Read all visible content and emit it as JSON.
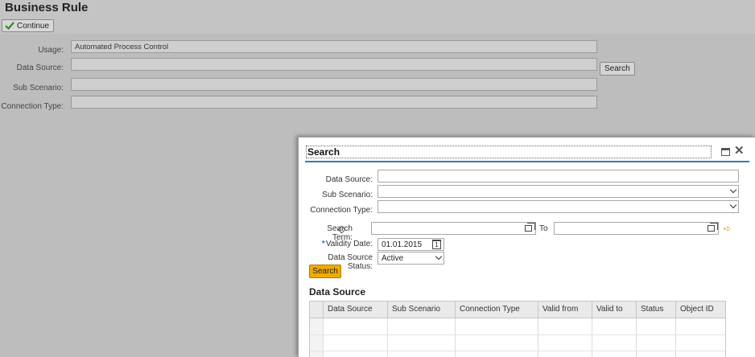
{
  "page": {
    "title": "Business Rule",
    "continue_label": "Continue",
    "form": {
      "usage_label": "Usage:",
      "usage_value": "Automated Process Control",
      "data_source_label": "Data Source:",
      "data_source_value": "",
      "search_label": "Search",
      "sub_scenario_label": "Sub Scenario:",
      "sub_scenario_value": "",
      "connection_type_label": "Connection Type:",
      "connection_type_value": ""
    }
  },
  "dialog": {
    "title": "Search",
    "data_source_label": "Data Source:",
    "data_source_value": "",
    "sub_scenario_label": "Sub Scenario:",
    "sub_scenario_value": "",
    "connection_type_label": "Connection Type:",
    "connection_type_value": "",
    "search_term_label": "Search Term:",
    "search_term_value": "",
    "to_label": "To",
    "to_value": "",
    "validity_date_label": "Validity Date:",
    "validity_date_value": "01.01.2015",
    "calendar_day": "1",
    "status_label": "Data Source Status:",
    "status_value": "Active",
    "search_button": "Search",
    "results_title": "Data Source",
    "columns": [
      "Data Source",
      "Sub Scenario",
      "Connection Type",
      "Valid from",
      "Valid to",
      "Status",
      "Object ID"
    ]
  },
  "colors": {
    "accent_blue": "#2b7dc0",
    "search_button": "#f0ab00",
    "overlay_gray": "#bdbdbd"
  }
}
